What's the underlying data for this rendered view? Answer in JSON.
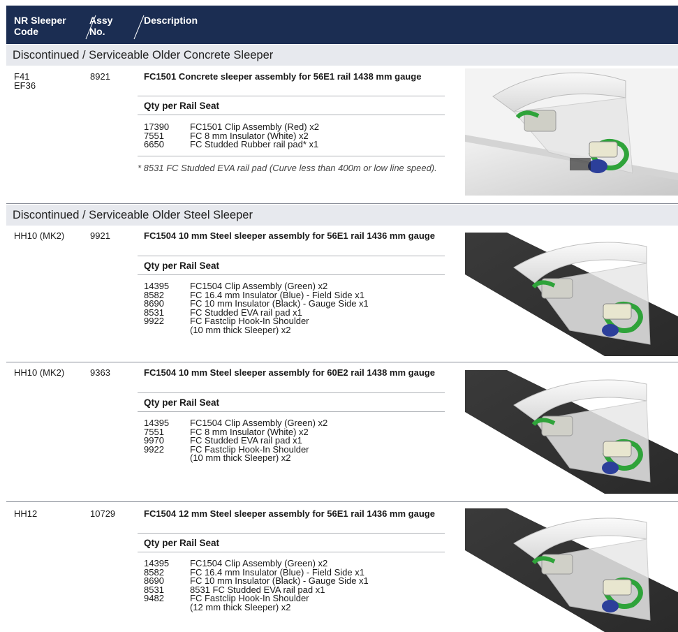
{
  "header": {
    "col1": "NR Sleeper\nCode",
    "col2": "Assy\nNo.",
    "col3": "Description"
  },
  "sections": [
    {
      "label": "Discontinued / Serviceable Older Concrete Sleeper"
    },
    {
      "label": "Discontinued / Serviceable Older Steel Sleeper"
    }
  ],
  "qty_label": "Qty per Rail Seat",
  "rows": [
    {
      "code": "F41\nEF36",
      "assy": "8921",
      "title": "FC1501 Concrete sleeper assembly for 56E1 rail 1438 mm gauge",
      "parts": [
        {
          "n": "17390",
          "d": "FC1501 Clip Assembly (Red) x2"
        },
        {
          "n": "7551",
          "d": "FC 8 mm Insulator (White) x2"
        },
        {
          "n": "6650",
          "d": "FC Studded Rubber rail pad* x1"
        }
      ],
      "note": "* 8531 FC Studded EVA rail pad (Curve less than 400m or low line speed).",
      "image": "concrete-sleeper-red-clip-illustration"
    },
    {
      "code": "HH10 (MK2)",
      "assy": "9921",
      "title": "FC1504 10 mm Steel sleeper assembly for 56E1 rail 1436 mm gauge",
      "parts": [
        {
          "n": "14395",
          "d": "FC1504 Clip Assembly (Green) x2"
        },
        {
          "n": "8582",
          "d": "FC 16.4 mm Insulator (Blue) - Field Side x1"
        },
        {
          "n": "8690",
          "d": "FC 10 mm Insulator (Black) - Gauge Side x1"
        },
        {
          "n": "8531",
          "d": "FC Studded EVA rail pad x1"
        },
        {
          "n": "9922",
          "d": "FC Fastclip Hook-In Shoulder\n(10 mm thick Sleeper) x2"
        }
      ],
      "image": "steel-sleeper-green-clip-illustration"
    },
    {
      "code": "HH10 (MK2)",
      "assy": "9363",
      "title": "FC1504 10 mm Steel sleeper assembly for 60E2 rail 1438 mm gauge",
      "parts": [
        {
          "n": "14395",
          "d": "FC1504 Clip Assembly (Green) x2"
        },
        {
          "n": "7551",
          "d": "FC 8 mm Insulator (White) x2"
        },
        {
          "n": "9970",
          "d": "FC Studded EVA rail pad x1"
        },
        {
          "n": "9922",
          "d": "FC Fastclip Hook-In Shoulder\n(10 mm thick Sleeper) x2"
        }
      ],
      "image": "steel-sleeper-green-clip-illustration"
    },
    {
      "code": "HH12",
      "assy": "10729",
      "title": "FC1504 12 mm Steel sleeper assembly for 56E1 rail 1436 mm gauge",
      "parts": [
        {
          "n": "14395",
          "d": "FC1504 Clip Assembly (Green) x2"
        },
        {
          "n": "8582",
          "d": "FC 16.4 mm Insulator (Blue) - Field Side x1"
        },
        {
          "n": "8690",
          "d": "FC 10 mm Insulator (Black) - Gauge Side x1"
        },
        {
          "n": "8531",
          "d": "8531 FC Studded EVA rail pad x1"
        },
        {
          "n": "9482",
          "d": "FC Fastclip Hook-In Shoulder\n(12 mm thick Sleeper) x2"
        }
      ],
      "image": "steel-sleeper-green-clip-illustration"
    }
  ],
  "colors": {
    "header_bg": "#1b2d52",
    "section_bg": "#e7e9ee",
    "clip_red": "#b82a2a",
    "clip_green": "#2fa33a",
    "insulator_blue": "#2c3f9a"
  }
}
